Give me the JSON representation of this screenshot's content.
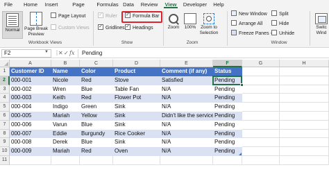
{
  "ribbon_tabs": [
    "File",
    "Home",
    "Insert",
    "Page Layout",
    "Formulas",
    "Data",
    "Review",
    "View",
    "Developer",
    "Help"
  ],
  "active_tab": "View",
  "ribbon": {
    "workbook_views": {
      "normal": "Normal",
      "page_break": "Page Break Preview",
      "page_layout": "Page Layout",
      "custom_views": "Custom Views",
      "label": "Workbook Views"
    },
    "show": {
      "ruler": "Ruler",
      "formula_bar": "Formula Bar",
      "gridlines": "Gridlines",
      "headings": "Headings",
      "label": "Show",
      "check_mark": "✓"
    },
    "zoom": {
      "zoom": "Zoom",
      "hundred": "100%",
      "zoom_to_selection": "Zoom to Selection",
      "label": "Zoom"
    },
    "window": {
      "new_window": "New Window",
      "arrange_all": "Arrange All",
      "freeze_panes": "Freeze Panes",
      "split": "Split",
      "hide": "Hide",
      "unhide": "Unhide",
      "label": "Window"
    },
    "switch": "Switc Wind"
  },
  "formula_bar": {
    "name_box": "F2",
    "fx": "fx",
    "formula": "Pending",
    "cancel": "✕",
    "enter": "✓",
    "more": "⋮"
  },
  "grid": {
    "columns": [
      "A",
      "B",
      "C",
      "D",
      "E",
      "F",
      "G",
      "H"
    ],
    "rows": [
      "1",
      "2",
      "3",
      "4",
      "5",
      "6",
      "7",
      "8",
      "9",
      "10",
      "11"
    ],
    "table_headers": [
      "Customer ID",
      "Name",
      "Color",
      "Product",
      "Comment (if any)",
      "Status"
    ],
    "table_rows": [
      [
        "000-001",
        "Nicole",
        "Red",
        "Stove",
        "Satisfied",
        "Pending"
      ],
      [
        "000-002",
        "Wren",
        "Blue",
        "Table Fan",
        "N/A",
        "Pending"
      ],
      [
        "000-003",
        "Keith",
        "Red",
        "Flower Pot",
        "N/A",
        "Pending"
      ],
      [
        "000-004",
        "Indigo",
        "Green",
        "Sink",
        "N/A",
        "Pending"
      ],
      [
        "000-005",
        "Mariah",
        "Yellow",
        "Sink",
        "Didn't like the service",
        "Pending"
      ],
      [
        "000-006",
        "Varun",
        "Blue",
        "Sink",
        "N/A",
        "Pending"
      ],
      [
        "000-007",
        "Eddie",
        "Burgundy",
        "Rice Cooker",
        "N/A",
        "Pending"
      ],
      [
        "000-008",
        "Derek",
        "Blue",
        "Sink",
        "N/A",
        "Pending"
      ],
      [
        "000-009",
        "Mariah",
        "Red",
        "Oven",
        "N/A",
        "Pending"
      ]
    ],
    "active_cell": "F2"
  },
  "colors": {
    "accent": "#217346",
    "table_header": "#4472c4",
    "table_band": "#d9e1f2",
    "highlight_box": "#d9232d"
  }
}
